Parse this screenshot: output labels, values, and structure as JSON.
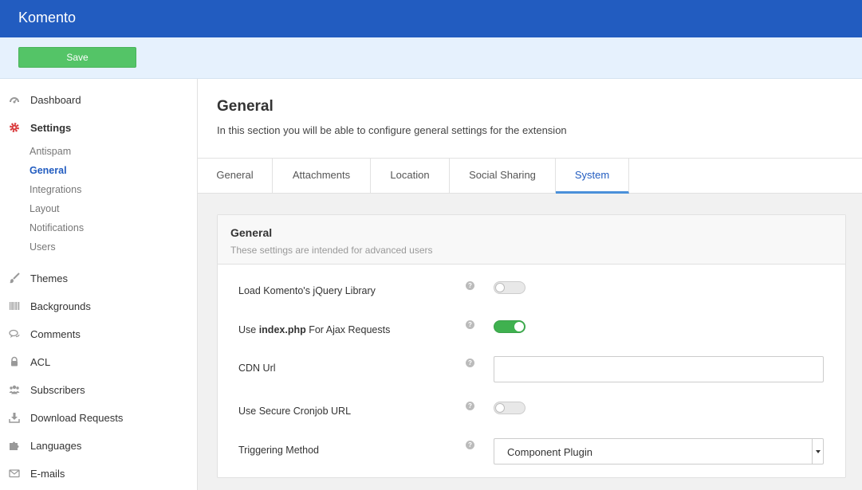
{
  "app": {
    "title": "Komento"
  },
  "toolbar": {
    "save_label": "Save"
  },
  "sidebar": {
    "items": [
      {
        "label": "Dashboard",
        "icon": "dashboard-icon"
      },
      {
        "label": "Settings",
        "icon": "gear-icon",
        "active": true
      },
      {
        "label": "Themes",
        "icon": "brush-icon"
      },
      {
        "label": "Backgrounds",
        "icon": "barcode-icon"
      },
      {
        "label": "Comments",
        "icon": "comments-icon"
      },
      {
        "label": "ACL",
        "icon": "lock-icon"
      },
      {
        "label": "Subscribers",
        "icon": "users-icon"
      },
      {
        "label": "Download Requests",
        "icon": "download-icon"
      },
      {
        "label": "Languages",
        "icon": "puzzle-icon"
      },
      {
        "label": "E-mails",
        "icon": "envelope-icon"
      }
    ],
    "settings_children": [
      {
        "label": "Antispam"
      },
      {
        "label": "General",
        "active": true
      },
      {
        "label": "Integrations"
      },
      {
        "label": "Layout"
      },
      {
        "label": "Notifications"
      },
      {
        "label": "Users"
      }
    ]
  },
  "page": {
    "title": "General",
    "description": "In this section you will be able to configure general settings for the extension"
  },
  "tabs": [
    {
      "label": "General"
    },
    {
      "label": "Attachments"
    },
    {
      "label": "Location"
    },
    {
      "label": "Social Sharing"
    },
    {
      "label": "System",
      "active": true
    }
  ],
  "panel": {
    "title": "General",
    "subtitle": "These settings are intended for advanced users",
    "help_glyph": "?",
    "rows": [
      {
        "label": "Load Komento's jQuery Library",
        "type": "toggle",
        "value": false
      },
      {
        "label_prefix": "Use ",
        "label_bold": "index.php",
        "label_suffix": " For Ajax Requests",
        "type": "toggle",
        "value": true
      },
      {
        "label": "CDN Url",
        "type": "text",
        "value": ""
      },
      {
        "label": "Use Secure Cronjob URL",
        "type": "toggle",
        "value": false
      },
      {
        "label": "Triggering Method",
        "type": "select",
        "value": "Component Plugin"
      }
    ]
  },
  "colors": {
    "topbar": "#225cc0",
    "save_button": "#54c467",
    "toggle_on": "#3fb14f",
    "active_link": "#225cc0"
  }
}
